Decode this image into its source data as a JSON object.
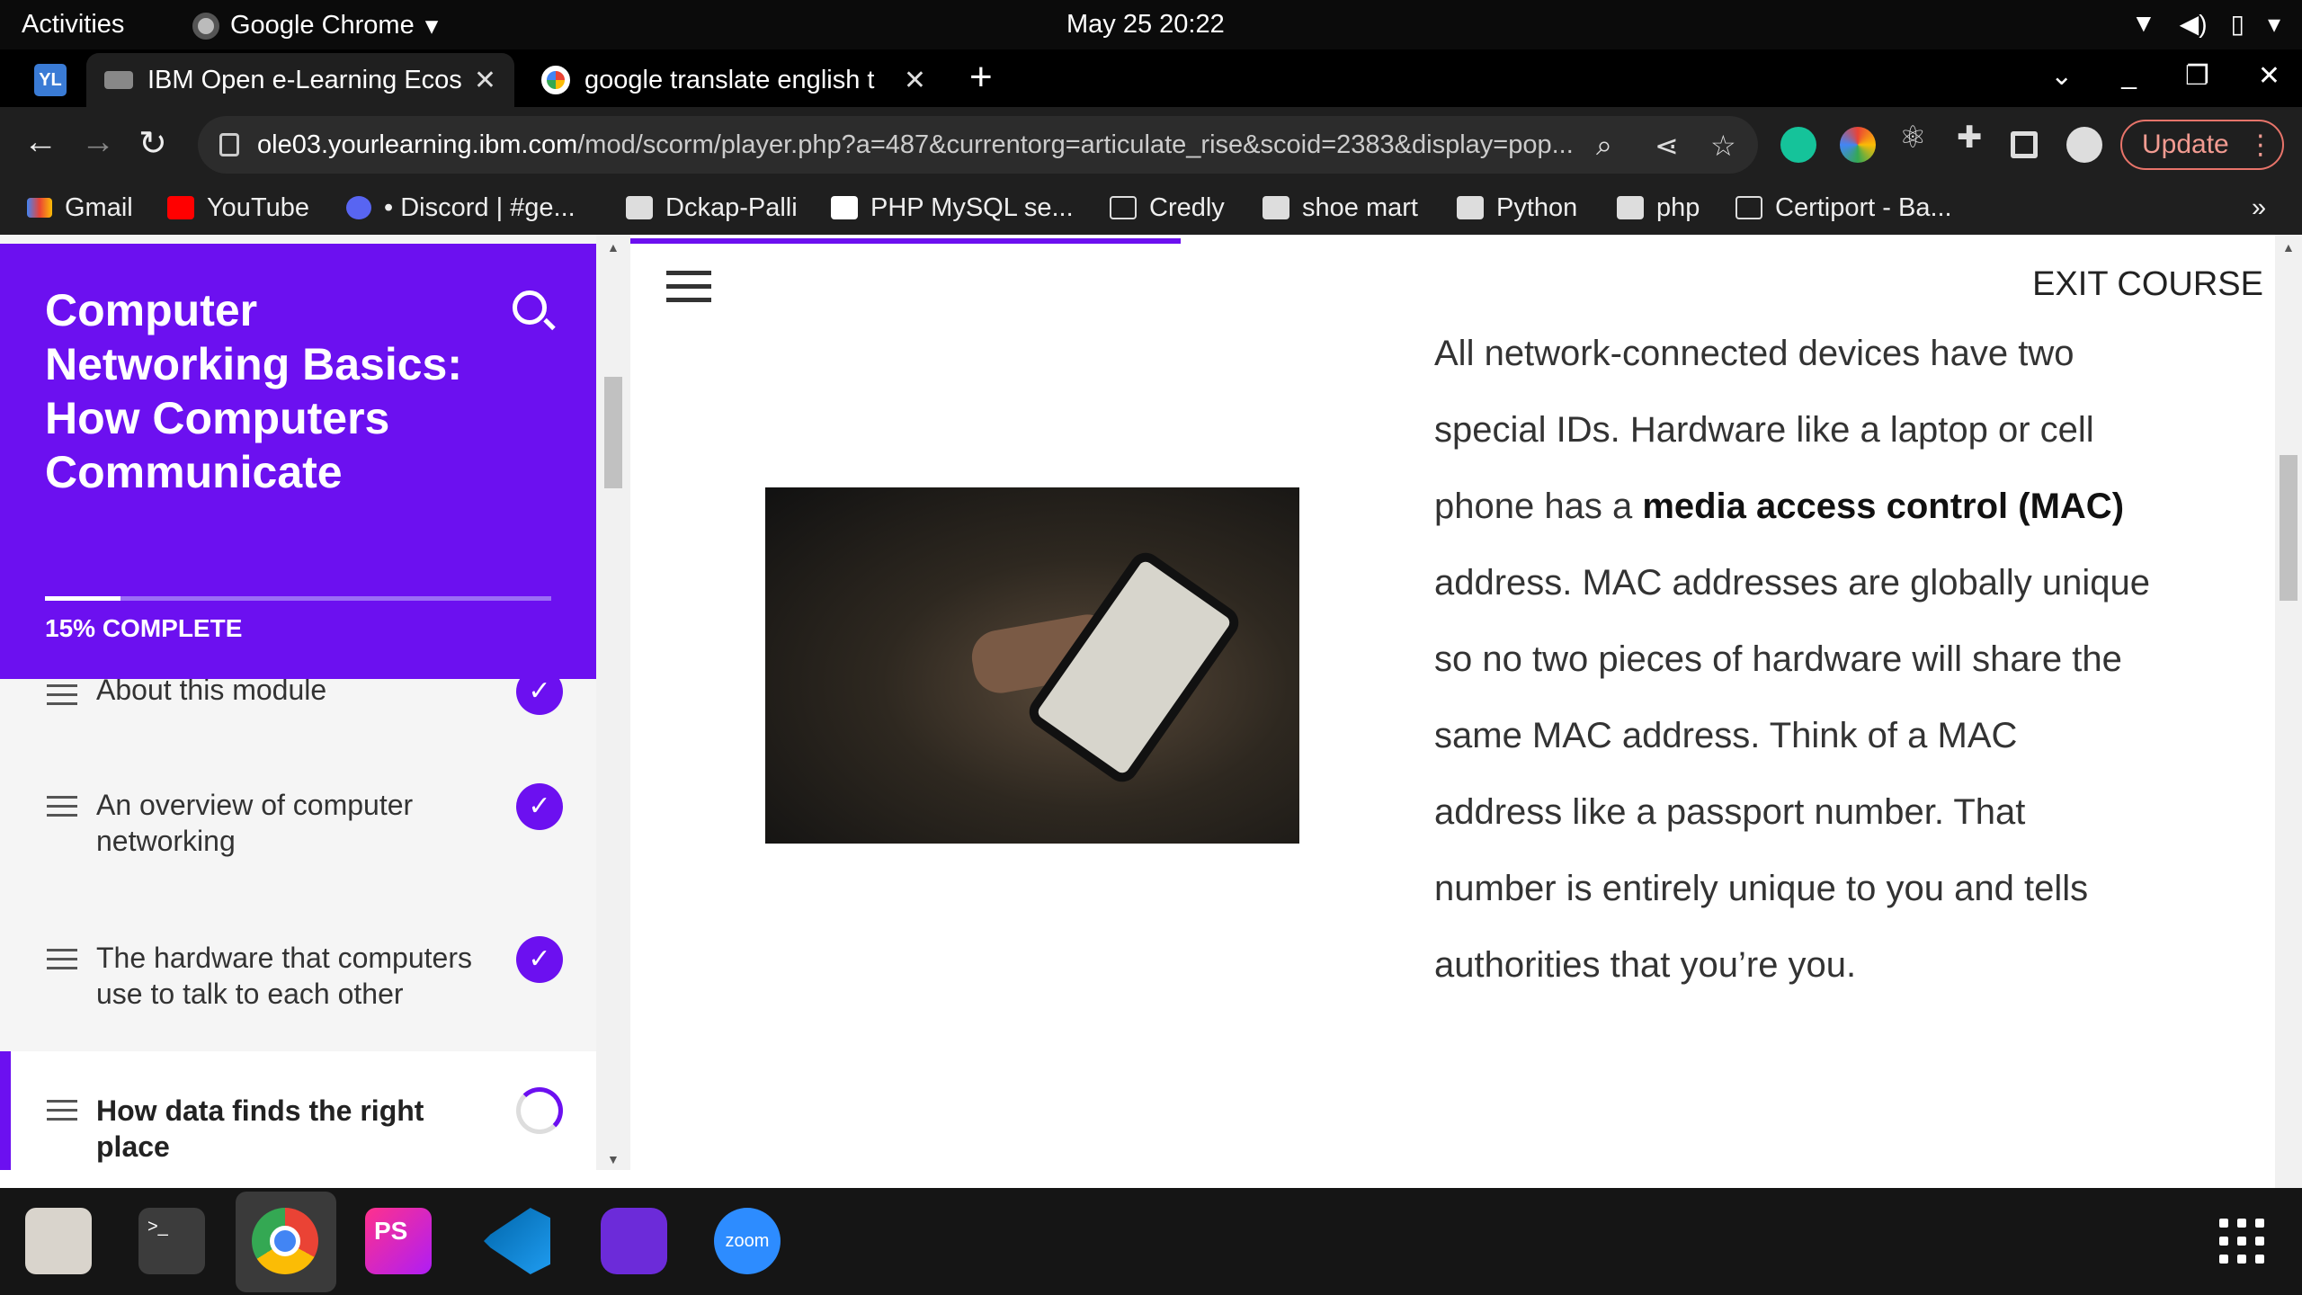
{
  "topbar": {
    "activities": "Activities",
    "app_name": "Google Chrome",
    "app_chevron": "▾",
    "clock": "May 25  20:22"
  },
  "tabs": [
    {
      "title": "IBM Open e-Learning Ecos",
      "close": "✕"
    },
    {
      "title": "google translate english t",
      "close": "✕"
    }
  ],
  "tabbar": {
    "new_tab": "+"
  },
  "toolbar": {
    "back": "←",
    "forward": "→",
    "reload": "↻",
    "url_host": "ole03.yourlearning.ibm.com",
    "url_path": "/mod/scorm/player.php?a=487&currentorg=articulate_rise&scoid=2383&display=pop...",
    "update_label": "Update",
    "update_menu": "⋮"
  },
  "bookmarks": [
    {
      "label": "Gmail"
    },
    {
      "label": "YouTube"
    },
    {
      "label": "• Discord | #ge..."
    },
    {
      "label": "Dckap-Palli"
    },
    {
      "label": "PHP MySQL se..."
    },
    {
      "label": "Credly"
    },
    {
      "label": "shoe mart"
    },
    {
      "label": "Python"
    },
    {
      "label": "php"
    },
    {
      "label": "Certiport - Ba..."
    }
  ],
  "bookmarks_more": "»",
  "sidebar": {
    "title": "Computer Networking Basics: How Computers Communicate",
    "progress_fraction": 0.15,
    "complete_label": "15% COMPLETE",
    "lessons": [
      {
        "label": "About this module",
        "status": "done"
      },
      {
        "label": "An overview of computer networking",
        "status": "done"
      },
      {
        "label": "The hardware that computers use to talk to each other",
        "status": "done"
      },
      {
        "label": "How data finds the right place",
        "status": "in-progress"
      }
    ],
    "check_glyph": "✓"
  },
  "main": {
    "exit_label": "EXIT COURSE",
    "paragraph_1": "All network-connected devices have two special IDs. Hardware like a laptop or cell phone has a ",
    "paragraph_bold": "media access control (MAC)",
    "paragraph_2": " address. MAC addresses are globally unique so no two pieces of hardware will share the same MAC address. Think of a MAC address like a passport number. That number is entirely unique to you and tells authorities that you’re you."
  },
  "dock": {
    "zoom_label": "zoom",
    "phpstorm_label": "PS"
  },
  "colors": {
    "accent": "#6c10f0",
    "update_border": "#e8746a"
  }
}
